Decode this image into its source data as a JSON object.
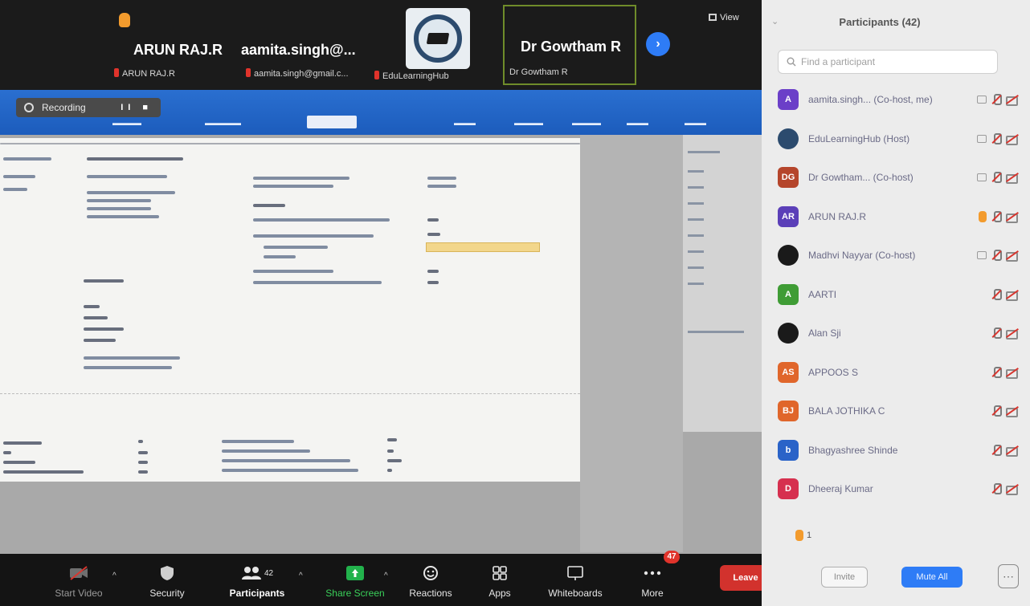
{
  "video_strip": {
    "tiles": [
      {
        "name": "ARUN RAJ.R",
        "subtitle": "ARUN RAJ.R"
      },
      {
        "name": "aamita.singh@...",
        "subtitle": "aamita.singh@gmail.c..."
      },
      {
        "name": "",
        "subtitle": "EduLearningHub"
      },
      {
        "name": "Dr Gowtham R",
        "subtitle": "Dr Gowtham R"
      }
    ],
    "view_label": "View"
  },
  "shared_screen": {
    "recording_label": "Recording"
  },
  "toolbar": {
    "items": [
      {
        "label": "Start Video",
        "icon": "video-off-icon"
      },
      {
        "label": "Security",
        "icon": "shield-icon"
      },
      {
        "label": "Participants",
        "icon": "participants-icon",
        "count": "42"
      },
      {
        "label": "Share Screen",
        "icon": "share-screen-icon"
      },
      {
        "label": "Reactions",
        "icon": "reactions-icon"
      },
      {
        "label": "Apps",
        "icon": "apps-icon"
      },
      {
        "label": "Whiteboards",
        "icon": "whiteboard-icon"
      },
      {
        "label": "More",
        "icon": "more-icon",
        "badge": "47"
      }
    ],
    "leave_label": "Leave"
  },
  "participants_panel": {
    "title": "Participants (42)",
    "search_placeholder": "Find a participant",
    "participants": [
      {
        "initials": "A",
        "name": "aamita.singh... (Co-host, me)",
        "color": "#6b3fc8"
      },
      {
        "initials": "",
        "name": "EduLearningHub (Host)",
        "color": "#2c4b6e"
      },
      {
        "initials": "DG",
        "name": "Dr Gowtham... (Co-host)",
        "color": "#b5452b"
      },
      {
        "initials": "AR",
        "name": "ARUN RAJ.R",
        "color": "#5b3fb8"
      },
      {
        "initials": "",
        "name": "Madhvi Nayyar (Co-host)",
        "color": "#1a1a1a"
      },
      {
        "initials": "A",
        "name": "AARTI",
        "color": "#3f9c35"
      },
      {
        "initials": "",
        "name": "Alan Sji",
        "color": "#1a1a1a"
      },
      {
        "initials": "AS",
        "name": "APPOOS S",
        "color": "#e0662b"
      },
      {
        "initials": "BJ",
        "name": "BALA JOTHIKA C",
        "color": "#e0662b"
      },
      {
        "initials": "b",
        "name": "Bhagyashree Shinde",
        "color": "#2a63c8"
      },
      {
        "initials": "D",
        "name": "Dheeraj Kumar",
        "color": "#d6304f"
      }
    ],
    "raised_hands_count": "1",
    "invite_label": "Invite",
    "mute_all_label": "Mute All"
  }
}
